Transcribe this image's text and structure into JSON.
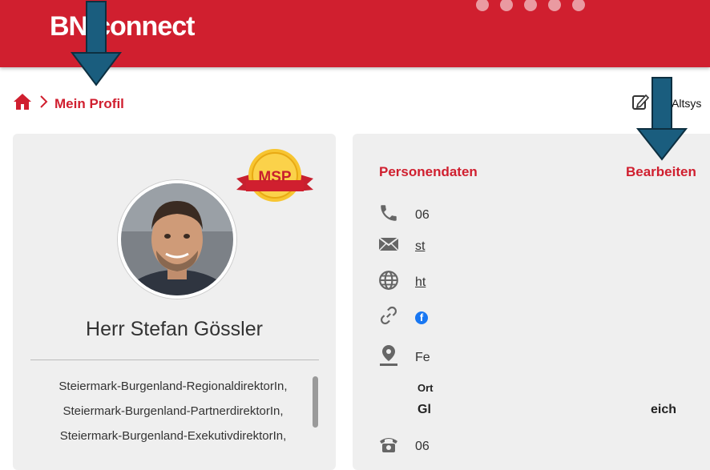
{
  "header": {
    "logo_bn": "BN",
    "logo_connect": "connect"
  },
  "breadcrumb": {
    "current": "Mein Profil"
  },
  "toolbar": {
    "altsys_label": "Altsys"
  },
  "profile": {
    "badge_label": "MSP",
    "name": "Herr Stefan Gössler",
    "roles": [
      "Steiermark-Burgenland-RegionaldirektorIn,",
      "Steiermark-Burgenland-PartnerdirektorIn,",
      "Steiermark-Burgenland-ExekutivdirektorIn,"
    ]
  },
  "personendaten": {
    "title": "Personendaten",
    "edit_label": "Bearbeiten",
    "phone": "06",
    "email": "st",
    "website": "ht",
    "social": "f",
    "address": "Fe",
    "ort_label": "Ort",
    "ort_value": "Gl",
    "ort_value_tail": "eich",
    "landline": "06"
  },
  "colors": {
    "brand": "#d01f2f",
    "arrow": "#1a5d7e"
  }
}
